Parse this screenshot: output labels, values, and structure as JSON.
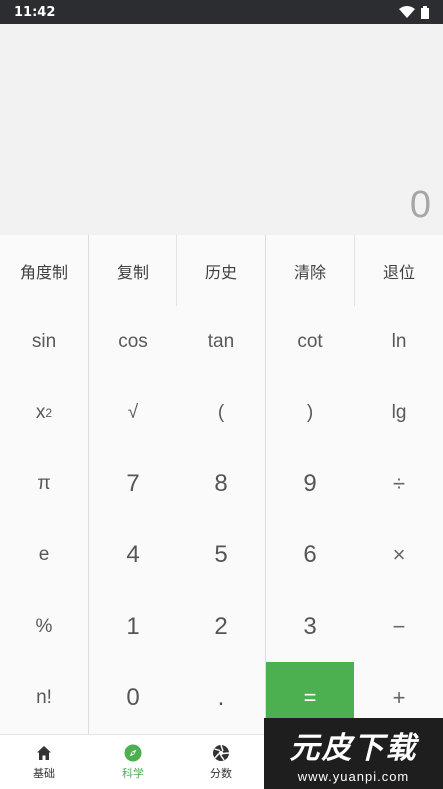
{
  "status_bar": {
    "time": "11:42"
  },
  "display": {
    "value": "0"
  },
  "colors": {
    "accent": "#4caf50",
    "display_bg": "#f2f2f2",
    "status_bg": "#2b2d31"
  },
  "keys": [
    [
      "角度制",
      "复制",
      "历史",
      "清除",
      "退位"
    ],
    [
      "sin",
      "cos",
      "tan",
      "cot",
      "ln"
    ],
    [
      "x",
      "√",
      "(",
      ")",
      "lg"
    ],
    [
      "π",
      "7",
      "8",
      "9",
      "÷"
    ],
    [
      "e",
      "4",
      "5",
      "6",
      "×"
    ],
    [
      "%",
      "1",
      "2",
      "3",
      "−"
    ],
    [
      "n!",
      "0",
      ".",
      "=",
      "+"
    ]
  ],
  "square_sup": "2",
  "bottom_nav": [
    {
      "label": "基础",
      "icon": "home-icon"
    },
    {
      "label": "科学",
      "icon": "compass-icon",
      "active": true
    },
    {
      "label": "分数",
      "icon": "aperture-icon"
    }
  ],
  "watermark": {
    "logo": "元皮下载",
    "url": "www.yuanpi.com"
  }
}
